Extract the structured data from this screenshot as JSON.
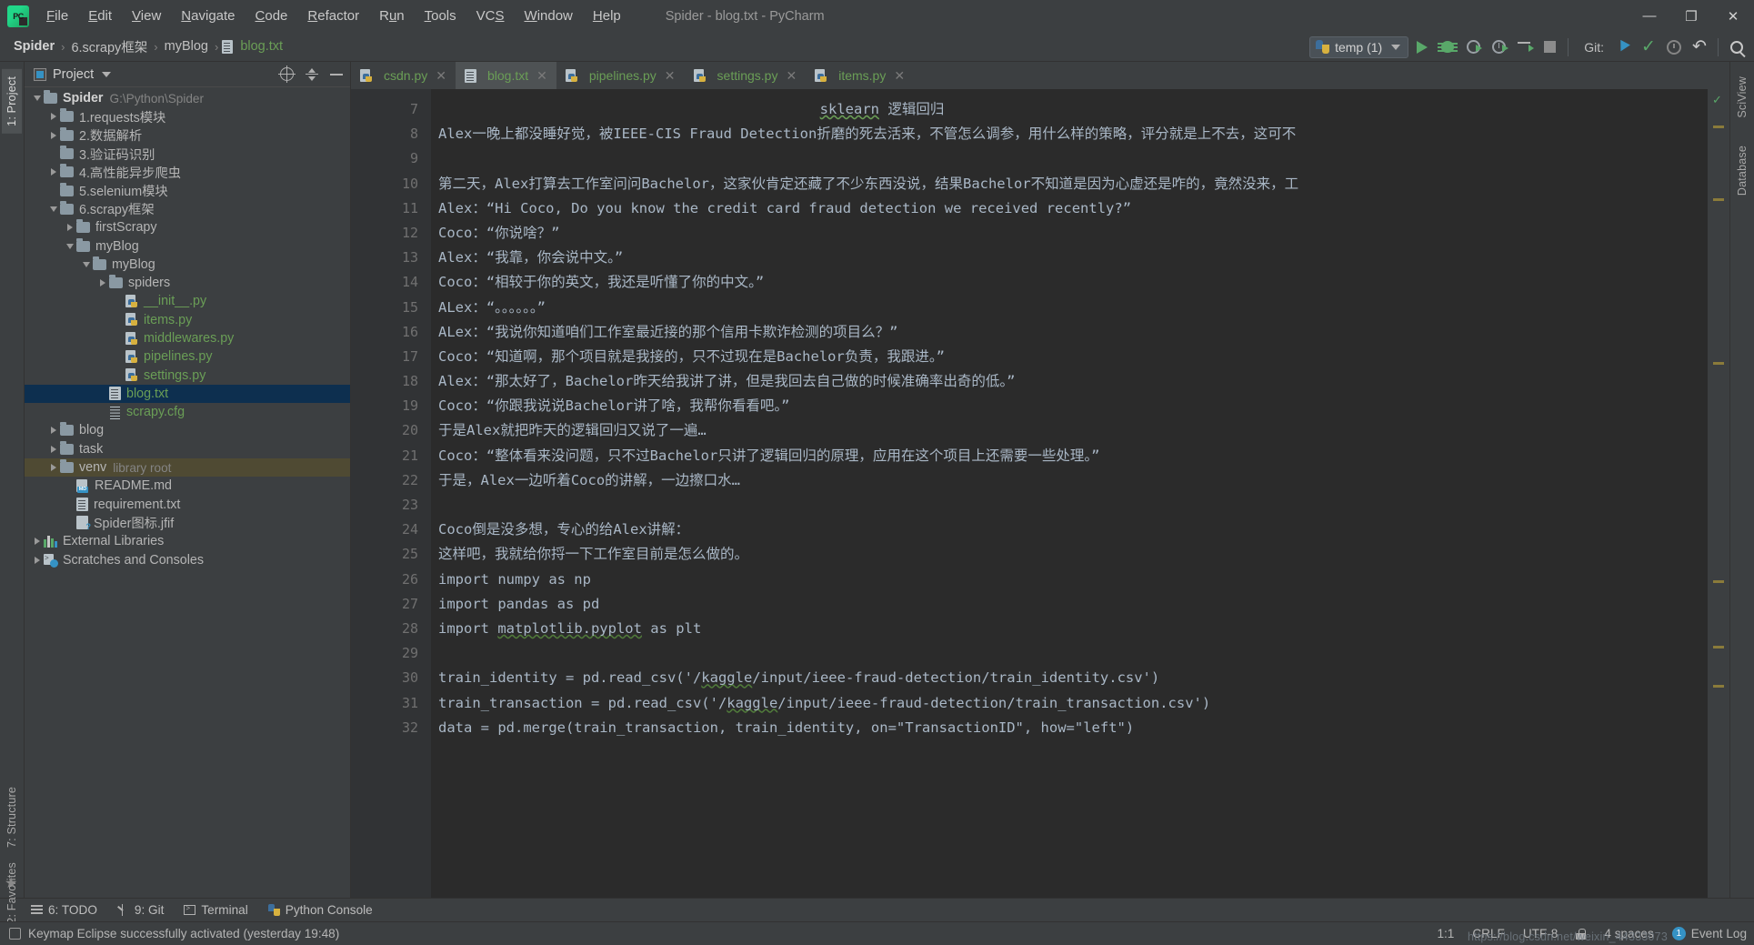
{
  "window": {
    "title": "Spider - blog.txt - PyCharm",
    "minimize": "—",
    "maximize": "❐",
    "close": "✕",
    "logo_text": "PC"
  },
  "menubar": {
    "items": [
      {
        "label": "File",
        "mnemonic": "F"
      },
      {
        "label": "Edit",
        "mnemonic": "E"
      },
      {
        "label": "View",
        "mnemonic": "V"
      },
      {
        "label": "Navigate",
        "mnemonic": "N"
      },
      {
        "label": "Code",
        "mnemonic": "C"
      },
      {
        "label": "Refactor",
        "mnemonic": "R"
      },
      {
        "label": "Run",
        "mnemonic": "u"
      },
      {
        "label": "Tools",
        "mnemonic": "T"
      },
      {
        "label": "VCS",
        "mnemonic": "S"
      },
      {
        "label": "Window",
        "mnemonic": "W"
      },
      {
        "label": "Help",
        "mnemonic": "H"
      }
    ]
  },
  "breadcrumb": {
    "separator": "›",
    "items": [
      {
        "label": "Spider",
        "type": "project"
      },
      {
        "label": "6.scrapy框架",
        "type": "folder"
      },
      {
        "label": "myBlog",
        "type": "folder"
      },
      {
        "label": "blog.txt",
        "type": "file"
      }
    ]
  },
  "toolbar": {
    "run_config": "temp (1)",
    "run_label": "Run",
    "debug_label": "Debug",
    "coverage_label": "Run with Coverage",
    "profile_label": "Profile",
    "concurrency_label": "Concurrency Diagram",
    "stop_label": "Stop",
    "git_label": "Git:",
    "git_update_label": "Update Project",
    "git_commit_label": "Commit",
    "git_history_label": "History",
    "git_rollback_label": "Rollback",
    "search_label": "Search Everywhere"
  },
  "left_strip": {
    "tabs": [
      {
        "label": "1: Project",
        "active": true
      },
      {
        "label": "7: Structure",
        "active": false
      },
      {
        "label": "2: Favorites",
        "active": false
      }
    ],
    "bookmark_icon": "★"
  },
  "right_strip": {
    "tabs": [
      {
        "label": "SciView"
      },
      {
        "label": "Database"
      }
    ]
  },
  "project_panel": {
    "title": "Project",
    "locate_label": "Select Opened File",
    "collapse_label": "Collapse All",
    "hide_label": "Hide",
    "tree": [
      {
        "depth": 0,
        "arrow": "down",
        "icon": "folder",
        "label": "Spider",
        "bold": true,
        "sub": "G:\\Python\\Spider"
      },
      {
        "depth": 1,
        "arrow": "right",
        "icon": "folder",
        "label": "1.requests模块"
      },
      {
        "depth": 1,
        "arrow": "right",
        "icon": "folder",
        "label": "2.数据解析"
      },
      {
        "depth": 1,
        "arrow": "none",
        "icon": "folder",
        "label": "3.验证码识别"
      },
      {
        "depth": 1,
        "arrow": "right",
        "icon": "folder",
        "label": "4.高性能异步爬虫"
      },
      {
        "depth": 1,
        "arrow": "none",
        "icon": "folder",
        "label": "5.selenium模块"
      },
      {
        "depth": 1,
        "arrow": "down",
        "icon": "folder",
        "label": "6.scrapy框架"
      },
      {
        "depth": 2,
        "arrow": "right",
        "icon": "folder",
        "label": "firstScrapy"
      },
      {
        "depth": 2,
        "arrow": "down",
        "icon": "folder",
        "label": "myBlog"
      },
      {
        "depth": 3,
        "arrow": "down",
        "icon": "folder",
        "label": "myBlog"
      },
      {
        "depth": 4,
        "arrow": "right",
        "icon": "folder",
        "label": "spiders"
      },
      {
        "depth": 5,
        "arrow": "none",
        "icon": "py",
        "label": "__init__.py",
        "green": true
      },
      {
        "depth": 5,
        "arrow": "none",
        "icon": "py",
        "label": "items.py",
        "green": true
      },
      {
        "depth": 5,
        "arrow": "none",
        "icon": "py",
        "label": "middlewares.py",
        "green": true
      },
      {
        "depth": 5,
        "arrow": "none",
        "icon": "py",
        "label": "pipelines.py",
        "green": true
      },
      {
        "depth": 5,
        "arrow": "none",
        "icon": "py",
        "label": "settings.py",
        "green": true
      },
      {
        "depth": 4,
        "arrow": "none",
        "icon": "txt",
        "label": "blog.txt",
        "green": true,
        "selected": true
      },
      {
        "depth": 4,
        "arrow": "none",
        "icon": "cfg",
        "label": "scrapy.cfg",
        "green": true
      },
      {
        "depth": 1,
        "arrow": "right",
        "icon": "folder",
        "label": "blog"
      },
      {
        "depth": 1,
        "arrow": "right",
        "icon": "folder",
        "label": "task"
      },
      {
        "depth": 1,
        "arrow": "right",
        "icon": "folder",
        "label": "venv",
        "sub": "library root",
        "venv": true
      },
      {
        "depth": 2,
        "arrow": "none",
        "icon": "md",
        "label": "README.md"
      },
      {
        "depth": 2,
        "arrow": "none",
        "icon": "txt2",
        "label": "requirement.txt"
      },
      {
        "depth": 2,
        "arrow": "none",
        "icon": "img",
        "label": "Spider图标.jfif"
      },
      {
        "depth": 0,
        "arrow": "right",
        "icon": "lib",
        "label": "External Libraries"
      },
      {
        "depth": 0,
        "arrow": "right",
        "icon": "scratch",
        "label": "Scratches and Consoles"
      }
    ]
  },
  "editor": {
    "tabs": [
      {
        "label": "csdn.py",
        "icon": "py",
        "active": false
      },
      {
        "label": "blog.txt",
        "icon": "txt",
        "active": true
      },
      {
        "label": "pipelines.py",
        "icon": "py",
        "active": false
      },
      {
        "label": "settings.py",
        "icon": "py",
        "active": false
      },
      {
        "label": "items.py",
        "icon": "py",
        "active": false
      }
    ],
    "close_glyph": "✕",
    "first_line_number": 7,
    "lines": [
      {
        "n": 7,
        "text": "sklearn 逻辑回归",
        "center": true,
        "squiggle_word": "sklearn"
      },
      {
        "n": 8,
        "text": "Alex一晚上都没睡好觉，被IEEE-CIS Fraud Detection折磨的死去活来，不管怎么调参，用什么样的策略，评分就是上不去，这可不"
      },
      {
        "n": 9,
        "text": ""
      },
      {
        "n": 10,
        "text": "第二天，Alex打算去工作室问问Bachelor，这家伙肯定还藏了不少东西没说，结果Bachelor不知道是因为心虚还是咋的，竟然没来，工"
      },
      {
        "n": 11,
        "text": "Alex：“Hi Coco, Do you know the credit card fraud detection we received recently?”"
      },
      {
        "n": 12,
        "text": "Coco：“你说啥？”"
      },
      {
        "n": 13,
        "text": "Alex：“我靠，你会说中文。”"
      },
      {
        "n": 14,
        "text": "Coco：“相较于你的英文，我还是听懂了你的中文。”"
      },
      {
        "n": 15,
        "text": "ALex：“。。。。。。”"
      },
      {
        "n": 16,
        "text": "ALex：“我说你知道咱们工作室最近接的那个信用卡欺诈检测的项目么？”"
      },
      {
        "n": 17,
        "text": "Coco：“知道啊，那个项目就是我接的，只不过现在是Bachelor负责，我跟进。”"
      },
      {
        "n": 18,
        "text": "Alex：“那太好了，Bachelor昨天给我讲了讲，但是我回去自己做的时候准确率出奇的低。”"
      },
      {
        "n": 19,
        "text": "Coco：“你跟我说说Bachelor讲了啥，我帮你看看吧。”"
      },
      {
        "n": 20,
        "text": "于是Alex就把昨天的逻辑回归又说了一遍…"
      },
      {
        "n": 21,
        "text": "Coco：“整体看来没问题，只不过Bachelor只讲了逻辑回归的原理，应用在这个项目上还需要一些处理。”"
      },
      {
        "n": 22,
        "text": "于是，Alex一边听着Coco的讲解，一边擦口水…"
      },
      {
        "n": 23,
        "text": ""
      },
      {
        "n": 24,
        "text": "Coco倒是没多想，专心的给Alex讲解："
      },
      {
        "n": 25,
        "text": "这样吧，我就给你捋一下工作室目前是怎么做的。"
      },
      {
        "n": 26,
        "text": "import numpy as np"
      },
      {
        "n": 27,
        "text": "import pandas as pd"
      },
      {
        "n": 28,
        "text": "import matplotlib.pyplot as plt",
        "squiggle_word": "matplotlib.pyplot"
      },
      {
        "n": 29,
        "text": ""
      },
      {
        "n": 30,
        "text": "train_identity = pd.read_csv('/kaggle/input/ieee-fraud-detection/train_identity.csv')",
        "squiggle_word": "kaggle"
      },
      {
        "n": 31,
        "text": "train_transaction = pd.read_csv('/kaggle/input/ieee-fraud-detection/train_transaction.csv')",
        "squiggle_word": "kaggle"
      },
      {
        "n": 32,
        "text": "data = pd.merge(train_transaction, train_identity, on=\"TransactionID\", how=\"left\")"
      }
    ]
  },
  "toolwindows": {
    "items": [
      {
        "label": "6: TODO",
        "icon": "todo"
      },
      {
        "label": "9: Git",
        "icon": "git"
      },
      {
        "label": "Terminal",
        "icon": "terminal"
      },
      {
        "label": "Python Console",
        "icon": "python"
      }
    ]
  },
  "statusbar": {
    "message": "Keymap Eclipse successfully activated (yesterday 19:48)",
    "caret": "1:1",
    "line_separator": "CRLF",
    "encoding": "UTF-8",
    "indent": "4 spaces",
    "event_log": "Event Log",
    "event_count": "1",
    "watermark": "https://blog.csdn.net/weixin_44333073"
  },
  "colors": {
    "accent_blue": "#3592c4",
    "green": "#59a869",
    "file_green": "#6a9e56",
    "selection": "#0d2f4f",
    "venv_highlight": "#4f4a33",
    "editor_bg": "#2b2b2b",
    "panel_bg": "#3c3f41",
    "gutter_bg": "#313335",
    "code_fg": "#a9b7c6"
  }
}
